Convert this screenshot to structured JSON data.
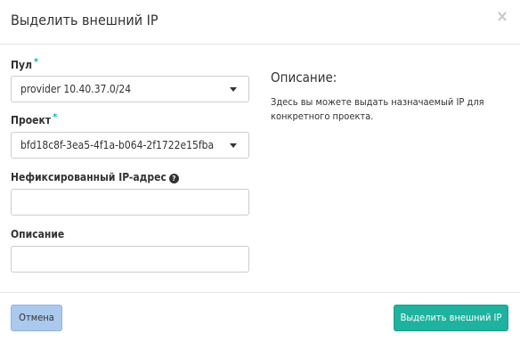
{
  "dialog": {
    "title": "Выделить внешний IP",
    "close_symbol": "×"
  },
  "form": {
    "pool": {
      "label": "Пул",
      "required_mark": "*",
      "selected": "provider 10.40.37.0/24"
    },
    "project": {
      "label": "Проект",
      "required_mark": "*",
      "selected": "bfd18c8f-3ea5-4f1a-b064-2f1722e15fba"
    },
    "floating_ip": {
      "label": "Нефиксированный IP-адрес",
      "help_symbol": "?",
      "value": ""
    },
    "description": {
      "label": "Описание",
      "value": ""
    }
  },
  "help_panel": {
    "title": "Описание:",
    "text": "Здесь вы можете выдать назначаемый IP для конкретного проекта."
  },
  "footer": {
    "cancel_label": "Отмена",
    "submit_label": "Выделить внешний IP"
  },
  "colors": {
    "required_star": "#1fb6a8",
    "primary_button": "#1fb29e",
    "cancel_button": "#aac9ec"
  },
  "icons": {
    "close": "close-icon",
    "help": "question-circle-icon",
    "dropdown": "caret-down-icon"
  }
}
